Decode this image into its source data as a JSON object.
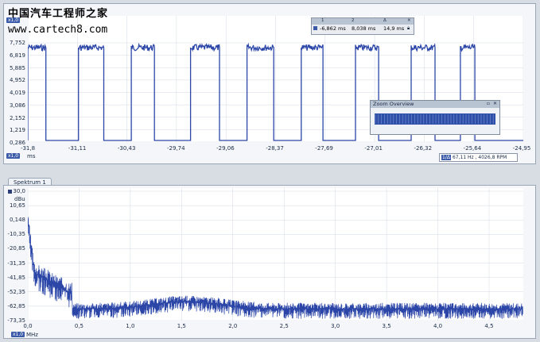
{
  "watermark": {
    "line1": "中国汽车工程师之家",
    "line2": "www.cartech8.com"
  },
  "scope": {
    "y_ticks": [
      "7,752",
      "6,819",
      "5,885",
      "4,952",
      "4,019",
      "3,086",
      "2,152",
      "1,219",
      "0,286"
    ],
    "x_ticks": [
      "-31,8",
      "-31,11",
      "-30,43",
      "-29,74",
      "-29,06",
      "-28,37",
      "-27,69",
      "-27,01",
      "-26,32",
      "-25,64",
      "-24,95"
    ],
    "x_unit": "ms",
    "unit_badge": "x1,0",
    "cursor_panel": {
      "headers": [
        "1",
        "2",
        "Δ"
      ],
      "values": [
        "-6,862 ms",
        "8,038 ms",
        "14,9 ms"
      ]
    },
    "zoom_overview": {
      "title": "Zoom Overview"
    },
    "freq_readout": {
      "badge": "1/Δ",
      "text": "67,11 Hz , 4026,8 RPM"
    },
    "pulses_on_ms": [
      [
        -31.8,
        -31.55
      ],
      [
        -31.1,
        -30.75
      ],
      [
        -30.37,
        -30.05
      ],
      [
        -29.55,
        -29.15
      ],
      [
        -28.77,
        -28.4
      ],
      [
        -28.02,
        -27.72
      ],
      [
        -27.27,
        -26.95
      ],
      [
        -26.5,
        -26.17
      ],
      [
        -25.82,
        -25.62
      ]
    ]
  },
  "spectrum": {
    "tab_label": "Spektrum 1",
    "y_ticks": [
      "30,0",
      "10,65",
      "0,148",
      "-10,35",
      "-20,85",
      "-31,35",
      "-41,85",
      "-52,35",
      "-62,85",
      "-73,35"
    ],
    "y_unit": "dBu",
    "x_ticks": [
      "0,0",
      "0,5",
      "1,0",
      "1,5",
      "2,0",
      "2,5",
      "3,0",
      "3,5",
      "4,0",
      "4,5"
    ],
    "x_unit": "MHz",
    "unit_badge": "x1,0"
  },
  "colors": {
    "trace": "#2c46a8",
    "grid": "#d3d9e2"
  }
}
